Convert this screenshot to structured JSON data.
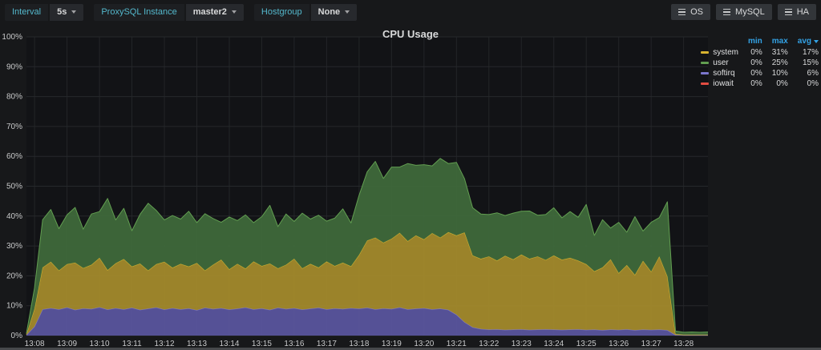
{
  "toolbar": {
    "variables": [
      {
        "label": "Interval",
        "value": "5s"
      },
      {
        "label": "ProxySQL Instance",
        "value": "master2"
      },
      {
        "label": "Hostgroup",
        "value": "None"
      }
    ],
    "nav_buttons": [
      {
        "label": "OS"
      },
      {
        "label": "MySQL"
      },
      {
        "label": "HA"
      }
    ]
  },
  "panel": {
    "title": "CPU Usage"
  },
  "legend": {
    "columns": [
      "min",
      "max",
      "avg"
    ],
    "sorted_column": "avg"
  },
  "colors": {
    "accent_teal": "#54b8cc",
    "legend_header_blue": "#33a2e5",
    "page_bg": "#17181a",
    "plot_bg": "#121316",
    "grid": "#26282b",
    "axis_text": "#c8c9ca"
  },
  "chart_data": {
    "type": "area",
    "stacked": true,
    "title": "CPU Usage",
    "xlabel": "",
    "ylabel": "",
    "ylim": [
      0,
      100
    ],
    "grid": true,
    "legend_position": "right-table",
    "y_tick_labels": [
      "0%",
      "10%",
      "20%",
      "30%",
      "40%",
      "50%",
      "60%",
      "70%",
      "80%",
      "90%",
      "100%"
    ],
    "x_tick_labels": [
      "13:08",
      "13:09",
      "13:10",
      "13:11",
      "13:12",
      "13:13",
      "13:14",
      "13:15",
      "13:16",
      "13:17",
      "13:18",
      "13:19",
      "13:20",
      "13:21",
      "13:22",
      "13:23",
      "13:24",
      "13:25",
      "13:26",
      "13:27",
      "13:28"
    ],
    "x_start": "13:07:45",
    "x_end": "13:28:45",
    "sample_interval_seconds": 15,
    "first_tick_offset_seconds": 15,
    "tick_interval_seconds": 60,
    "stack_order": [
      "iowait",
      "softirq",
      "system",
      "user"
    ],
    "series": [
      {
        "name": "system",
        "min": "0%",
        "max": "31%",
        "avg": "17%",
        "line_color": "#d9b430",
        "fill_color": "#a68c2c",
        "values": [
          0.2,
          6.0,
          14.0,
          15.5,
          13.0,
          14.5,
          15.8,
          13.5,
          14.8,
          16.5,
          13.2,
          15.0,
          16.8,
          13.8,
          15.5,
          12.8,
          14.5,
          16.0,
          13.5,
          15.2,
          14.0,
          15.8,
          12.5,
          14.8,
          16.2,
          13.5,
          15.0,
          13.0,
          16.0,
          14.2,
          15.5,
          13.2,
          14.8,
          16.5,
          13.8,
          15.0,
          13.5,
          16.0,
          14.2,
          15.5,
          14.0,
          18.0,
          22.5,
          24.0,
          22.0,
          23.5,
          25.0,
          22.8,
          24.5,
          23.0,
          25.5,
          23.8,
          26.0,
          26.5,
          30.0,
          24.0,
          23.5,
          24.5,
          23.0,
          24.8,
          23.5,
          25.0,
          23.8,
          24.5,
          23.2,
          24.8,
          23.5,
          24.0,
          23.0,
          22.0,
          19.5,
          21.0,
          23.5,
          19.0,
          21.5,
          18.5,
          23.0,
          19.5,
          24.5,
          18.0,
          0.3,
          0.2,
          0.2,
          0.2,
          0.2
        ]
      },
      {
        "name": "user",
        "min": "0%",
        "max": "25%",
        "avg": "15%",
        "line_color": "#629e51",
        "fill_color": "#3f6b3b",
        "values": [
          0.4,
          7.0,
          16.0,
          17.5,
          14.0,
          16.5,
          18.5,
          13.0,
          17.0,
          15.5,
          24.0,
          14.5,
          17.0,
          12.0,
          16.5,
          22.5,
          18.0,
          14.0,
          17.5,
          15.0,
          18.5,
          13.5,
          19.0,
          15.5,
          12.5,
          17.5,
          14.5,
          18.0,
          13.0,
          16.5,
          19.5,
          14.0,
          17.0,
          12.5,
          18.5,
          15.0,
          17.5,
          13.5,
          16.0,
          18.0,
          14.5,
          20.0,
          23.0,
          25.5,
          21.5,
          24.0,
          22.0,
          26.0,
          23.5,
          25.0,
          22.5,
          26.5,
          23.0,
          24.5,
          18.0,
          16.0,
          15.0,
          14.0,
          16.0,
          13.5,
          15.5,
          14.5,
          16.0,
          13.8,
          15.2,
          16.0,
          14.0,
          15.5,
          14.5,
          20.0,
          12.0,
          16.0,
          10.5,
          17.0,
          11.0,
          19.5,
          10.0,
          16.5,
          13.0,
          25.0,
          1.0,
          0.8,
          0.9,
          0.8,
          0.9
        ]
      },
      {
        "name": "softirq",
        "min": "0%",
        "max": "10%",
        "avg": "6%",
        "line_color": "#7b76cc",
        "fill_color": "#5a56a0",
        "values": [
          0.2,
          3.0,
          8.8,
          9.2,
          8.8,
          9.4,
          8.6,
          9.1,
          8.9,
          9.5,
          8.7,
          9.2,
          8.8,
          9.3,
          8.6,
          9.0,
          9.4,
          8.7,
          9.2,
          8.8,
          9.1,
          8.5,
          9.3,
          8.9,
          9.2,
          8.7,
          9.0,
          9.4,
          8.8,
          9.1,
          8.6,
          9.3,
          8.9,
          9.2,
          8.7,
          9.0,
          9.3,
          8.8,
          9.1,
          8.9,
          9.2,
          9.0,
          9.3,
          8.8,
          9.1,
          8.9,
          9.4,
          8.8,
          9.0,
          9.2,
          8.8,
          9.0,
          8.6,
          7.0,
          4.5,
          2.8,
          2.2,
          2.0,
          2.1,
          1.9,
          2.0,
          2.1,
          1.9,
          2.0,
          2.1,
          2.0,
          1.9,
          2.0,
          2.1,
          1.9,
          2.0,
          1.8,
          2.0,
          1.9,
          2.1,
          1.8,
          2.0,
          1.9,
          2.0,
          1.8,
          0.2,
          0.1,
          0.1,
          0.1,
          0.1
        ]
      },
      {
        "name": "iowait",
        "min": "0%",
        "max": "0%",
        "avg": "0%",
        "line_color": "#e24d42",
        "fill_color": "#7d2b25",
        "values": [
          0,
          0,
          0,
          0,
          0,
          0,
          0,
          0,
          0,
          0,
          0,
          0,
          0,
          0,
          0,
          0,
          0,
          0,
          0,
          0,
          0,
          0,
          0,
          0,
          0,
          0,
          0,
          0,
          0,
          0,
          0,
          0,
          0,
          0,
          0,
          0,
          0,
          0,
          0,
          0,
          0,
          0,
          0,
          0,
          0,
          0,
          0,
          0,
          0,
          0,
          0,
          0,
          0,
          0,
          0,
          0,
          0,
          0,
          0,
          0,
          0,
          0,
          0,
          0,
          0,
          0,
          0,
          0,
          0,
          0,
          0,
          0,
          0,
          0,
          0,
          0,
          0,
          0,
          0,
          0,
          0,
          0,
          0,
          0,
          0
        ]
      }
    ]
  }
}
